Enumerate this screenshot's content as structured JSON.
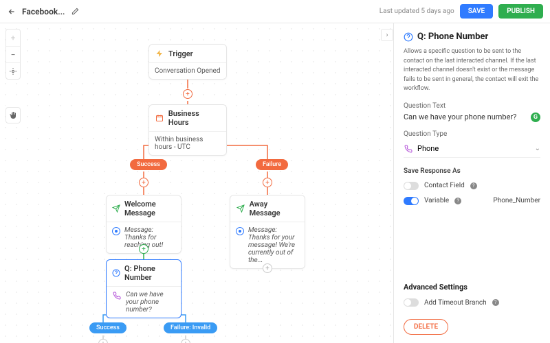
{
  "header": {
    "title": "Facebook...",
    "updated": "Last updated 5 days ago",
    "save": "SAVE",
    "publish": "PUBLISH"
  },
  "canvas": {
    "trigger": {
      "title": "Trigger",
      "body": "Conversation Opened"
    },
    "hours": {
      "title": "Business Hours",
      "body": "Within business hours - UTC"
    },
    "success_pill": "Success",
    "failure_pill": "Failure",
    "welcome": {
      "title": "Welcome Message",
      "prefix": "Message:",
      "body": "Thanks for reaching out!"
    },
    "away": {
      "title": "Away Message",
      "prefix": "Message:",
      "body": "Thanks for your message! We're currently out of the..."
    },
    "question": {
      "title": "Q: Phone Number",
      "body": "Can we have your phone number?"
    },
    "q_success": "Success",
    "q_failure": "Failure: Invalid"
  },
  "sidebar": {
    "title": "Q: Phone Number",
    "description": "Allows a specific question to be sent to the contact on the last interacted channel. If the last interacted channel doesn't exist or the message fails to be sent in general, the contact will exit the workflow.",
    "question_text_label": "Question Text",
    "question_text_value": "Can we have your phone number?",
    "question_type_label": "Question Type",
    "question_type_value": "Phone",
    "save_response_label": "Save Response As",
    "contact_field": "Contact Field",
    "variable": "Variable",
    "variable_name": "Phone_Number",
    "advanced": "Advanced Settings",
    "timeout": "Add Timeout Branch",
    "delete": "DELETE"
  }
}
